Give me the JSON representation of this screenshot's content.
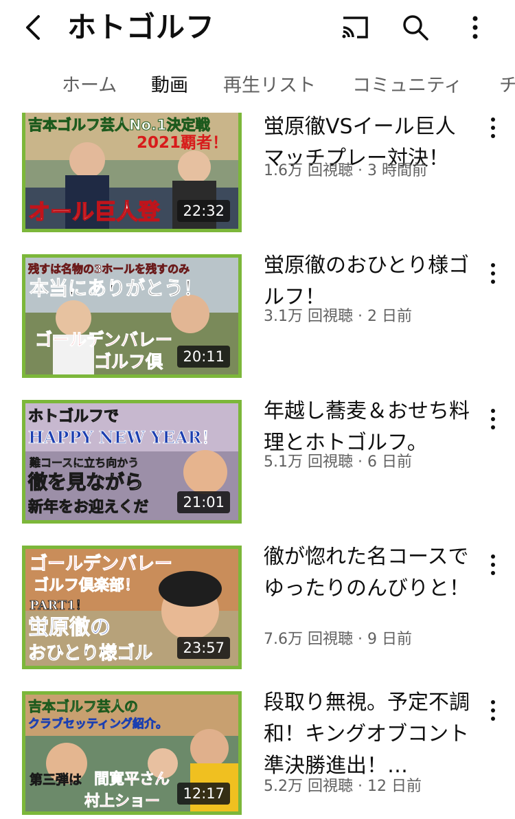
{
  "header": {
    "title": "ホトゴルフ",
    "icons": [
      "back-arrow-icon",
      "cast-icon",
      "search-icon",
      "more-vert-icon"
    ]
  },
  "tabs": [
    "ホーム",
    "動画",
    "再生リスト",
    "コミュニティ",
    "チ"
  ],
  "videos": [
    {
      "title": "蛍原徹VSイール巨人マッチプレー対決！",
      "views": "1.6万 回視聴",
      "age": "3 時間前",
      "duration": "22:32",
      "thumb_lines": [
        "吉本ゴルフ芸人No.1決定戦",
        "2021覇者！",
        "オール巨人登"
      ]
    },
    {
      "title": "蛍原徹のおひとり様ゴルフ！",
      "views": "3.1万 回視聴",
      "age": "2 日前",
      "duration": "20:11",
      "thumb_lines": [
        "残すは名物の3ホールを残すのみ",
        "本当にありがとう！",
        "ゴールデンバレー",
        "ゴルフ倶"
      ]
    },
    {
      "title": "年越し蕎麦＆おせち料理とホトゴルフ。",
      "views": "5.1万 回視聴",
      "age": "6 日前",
      "duration": "21:01",
      "thumb_lines": [
        "ホトゴルフで",
        "HAPPY NEW YEAR！",
        "難コースに立ち向かう",
        "徹を見ながら",
        "新年をお迎えくだ"
      ]
    },
    {
      "title": "徹が惚れた名コースでゆったりのんびりと！",
      "views": "7.6万 回視聴",
      "age": "9 日前",
      "duration": "23:57",
      "thumb_lines": [
        "ゴールデンバレー",
        "ゴルフ倶楽部！",
        "PART1！",
        "蛍原徹の",
        "おひとり様ゴル"
      ]
    },
    {
      "title": "段取り無視。予定不調和！キングオブコント準決勝進出！…",
      "views": "5.2万 回視聴",
      "age": "12 日前",
      "duration": "12:17",
      "thumb_lines": [
        "吉本ゴルフ芸人の",
        "クラブセッティング紹介。",
        "第三弾は",
        "間寛平さん",
        "村上ショー"
      ]
    }
  ],
  "colors": {
    "accent_border": "#7cb73a",
    "secondary_text": "#606060"
  }
}
